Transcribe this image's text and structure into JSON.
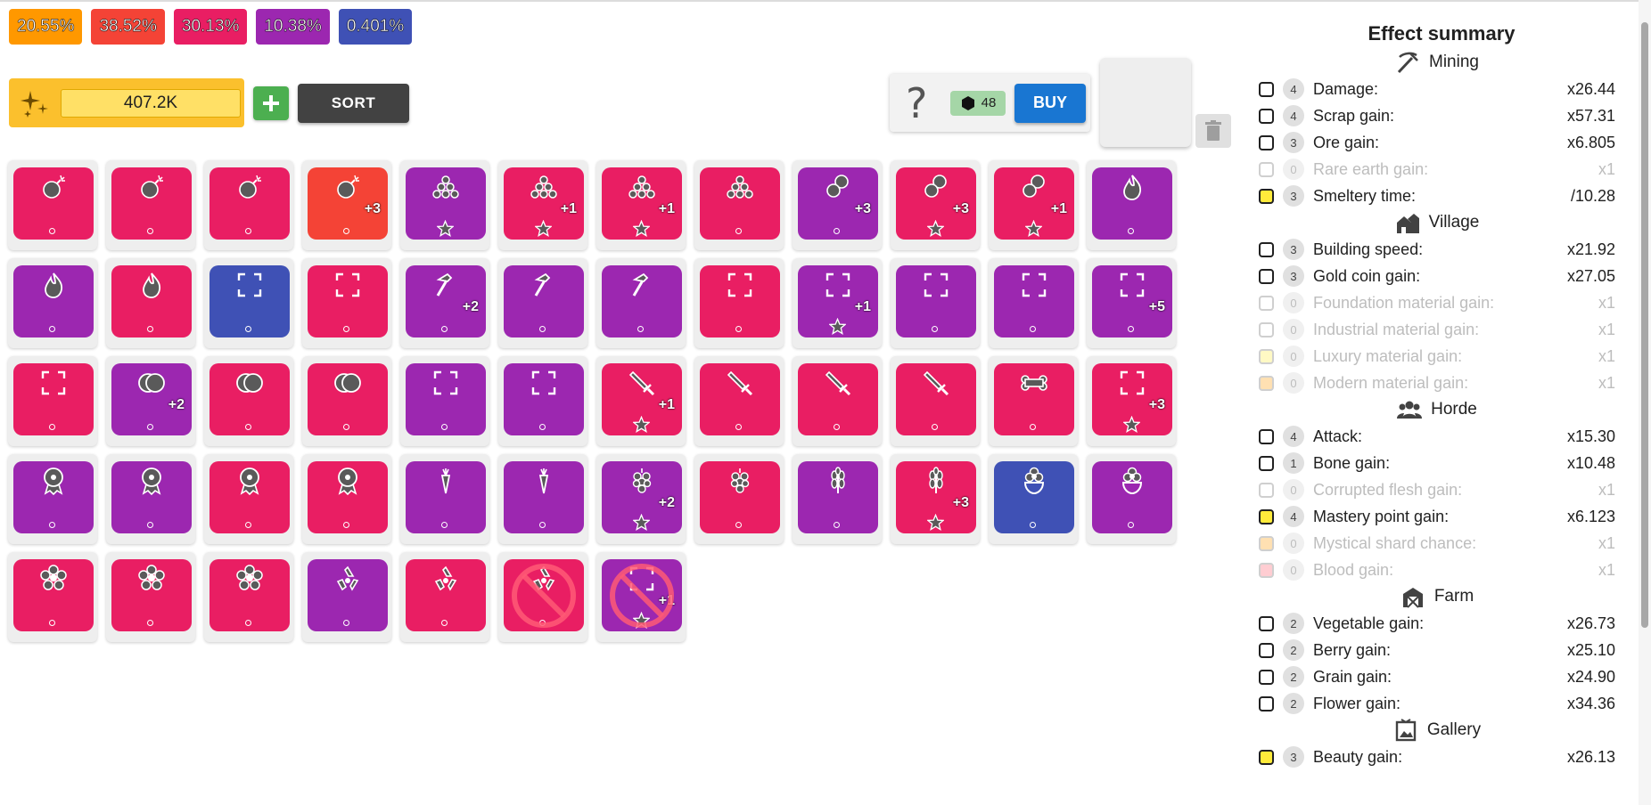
{
  "rarity_chips": [
    {
      "label": "20.55%",
      "color": "#ff9800"
    },
    {
      "label": "38.52%",
      "color": "#f44336"
    },
    {
      "label": "30.13%",
      "color": "#e91e63"
    },
    {
      "label": "10.38%",
      "color": "#9c27b0"
    },
    {
      "label": "0.401%",
      "color": "#3f51b5"
    }
  ],
  "currency": {
    "amount": "407.2K",
    "icon": "sparkle-icon"
  },
  "toolbar": {
    "sort_label": "SORT",
    "add_icon": "plus-icon"
  },
  "buy_panel": {
    "help": "?",
    "cost": "48",
    "cost_icon": "hexagon-icon",
    "buy_label": "BUY"
  },
  "colors": {
    "red": "#f44336",
    "pink": "#e91e63",
    "purple": "#9c27b0",
    "indigo": "#3f51b5"
  },
  "cards": [
    {
      "color": "pink",
      "icon": "bomb",
      "bonus": "",
      "star": false,
      "banned": false
    },
    {
      "color": "pink",
      "icon": "bomb",
      "bonus": "",
      "star": false,
      "banned": false
    },
    {
      "color": "pink",
      "icon": "bomb",
      "bonus": "",
      "star": false,
      "banned": false
    },
    {
      "color": "red",
      "icon": "bomb",
      "bonus": "+3",
      "star": false,
      "banned": false
    },
    {
      "color": "purple",
      "icon": "ore-pile",
      "bonus": "",
      "star": true,
      "banned": false
    },
    {
      "color": "pink",
      "icon": "ore-pile",
      "bonus": "+1",
      "star": true,
      "banned": false
    },
    {
      "color": "pink",
      "icon": "ore-pile",
      "bonus": "+1",
      "star": true,
      "banned": false
    },
    {
      "color": "pink",
      "icon": "ore-pile",
      "bonus": "",
      "star": false,
      "banned": false
    },
    {
      "color": "purple",
      "icon": "scrap",
      "bonus": "+3",
      "star": false,
      "banned": false
    },
    {
      "color": "pink",
      "icon": "scrap",
      "bonus": "+3",
      "star": true,
      "banned": false
    },
    {
      "color": "pink",
      "icon": "scrap",
      "bonus": "+1",
      "star": true,
      "banned": false
    },
    {
      "color": "purple",
      "icon": "fire",
      "bonus": "",
      "star": false,
      "banned": false
    },
    {
      "color": "purple",
      "icon": "fire",
      "bonus": "",
      "star": false,
      "banned": false
    },
    {
      "color": "pink",
      "icon": "fire",
      "bonus": "",
      "star": false,
      "banned": false
    },
    {
      "color": "indigo",
      "icon": "expand",
      "bonus": "",
      "star": false,
      "banned": false
    },
    {
      "color": "pink",
      "icon": "expand",
      "bonus": "",
      "star": false,
      "banned": false
    },
    {
      "color": "purple",
      "icon": "hammer",
      "bonus": "+2",
      "star": false,
      "banned": false
    },
    {
      "color": "purple",
      "icon": "hammer",
      "bonus": "",
      "star": false,
      "banned": false
    },
    {
      "color": "purple",
      "icon": "hammer",
      "bonus": "",
      "star": false,
      "banned": false
    },
    {
      "color": "pink",
      "icon": "expand",
      "bonus": "",
      "star": false,
      "banned": false
    },
    {
      "color": "purple",
      "icon": "expand",
      "bonus": "+1",
      "star": true,
      "banned": false
    },
    {
      "color": "purple",
      "icon": "expand",
      "bonus": "",
      "star": false,
      "banned": false
    },
    {
      "color": "purple",
      "icon": "expand",
      "bonus": "",
      "star": false,
      "banned": false
    },
    {
      "color": "purple",
      "icon": "expand",
      "bonus": "+5",
      "star": false,
      "banned": false
    },
    {
      "color": "pink",
      "icon": "expand",
      "bonus": "",
      "star": false,
      "banned": false
    },
    {
      "color": "purple",
      "icon": "coins",
      "bonus": "+2",
      "star": false,
      "banned": false
    },
    {
      "color": "pink",
      "icon": "coins",
      "bonus": "",
      "star": false,
      "banned": false
    },
    {
      "color": "pink",
      "icon": "coins",
      "bonus": "",
      "star": false,
      "banned": false
    },
    {
      "color": "purple",
      "icon": "expand",
      "bonus": "",
      "star": false,
      "banned": false
    },
    {
      "color": "purple",
      "icon": "expand",
      "bonus": "",
      "star": false,
      "banned": false
    },
    {
      "color": "pink",
      "icon": "sword",
      "bonus": "+1",
      "star": true,
      "banned": false
    },
    {
      "color": "pink",
      "icon": "sword",
      "bonus": "",
      "star": false,
      "banned": false
    },
    {
      "color": "pink",
      "icon": "sword",
      "bonus": "",
      "star": false,
      "banned": false
    },
    {
      "color": "pink",
      "icon": "sword",
      "bonus": "",
      "star": false,
      "banned": false
    },
    {
      "color": "pink",
      "icon": "bone",
      "bonus": "",
      "star": false,
      "banned": false
    },
    {
      "color": "pink",
      "icon": "expand",
      "bonus": "+3",
      "star": true,
      "banned": false
    },
    {
      "color": "purple",
      "icon": "medal",
      "bonus": "",
      "star": false,
      "banned": false
    },
    {
      "color": "purple",
      "icon": "medal",
      "bonus": "",
      "star": false,
      "banned": false
    },
    {
      "color": "pink",
      "icon": "medal",
      "bonus": "",
      "star": false,
      "banned": false
    },
    {
      "color": "pink",
      "icon": "medal",
      "bonus": "",
      "star": false,
      "banned": false
    },
    {
      "color": "purple",
      "icon": "carrot",
      "bonus": "",
      "star": false,
      "banned": false
    },
    {
      "color": "purple",
      "icon": "carrot",
      "bonus": "",
      "star": false,
      "banned": false
    },
    {
      "color": "purple",
      "icon": "grapes",
      "bonus": "+2",
      "star": true,
      "banned": false
    },
    {
      "color": "pink",
      "icon": "grapes",
      "bonus": "",
      "star": false,
      "banned": false
    },
    {
      "color": "purple",
      "icon": "grain",
      "bonus": "",
      "star": false,
      "banned": false
    },
    {
      "color": "pink",
      "icon": "grain",
      "bonus": "+3",
      "star": true,
      "banned": false
    },
    {
      "color": "indigo",
      "icon": "flower",
      "bonus": "",
      "star": false,
      "banned": false
    },
    {
      "color": "purple",
      "icon": "flower",
      "bonus": "",
      "star": false,
      "banned": false
    },
    {
      "color": "pink",
      "icon": "blossom",
      "bonus": "",
      "star": false,
      "banned": false
    },
    {
      "color": "pink",
      "icon": "blossom",
      "bonus": "",
      "star": false,
      "banned": false
    },
    {
      "color": "pink",
      "icon": "blossom",
      "bonus": "",
      "star": false,
      "banned": false
    },
    {
      "color": "purple",
      "icon": "recycle",
      "bonus": "",
      "star": false,
      "banned": false
    },
    {
      "color": "pink",
      "icon": "recycle",
      "bonus": "",
      "star": false,
      "banned": false
    },
    {
      "color": "pink",
      "icon": "recycle",
      "bonus": "",
      "star": false,
      "banned": true
    },
    {
      "color": "purple",
      "icon": "expand",
      "bonus": "+1",
      "star": true,
      "banned": true
    }
  ],
  "summary": {
    "title": "Effect summary",
    "sections": [
      {
        "name": "Mining",
        "icon": "pickaxe-icon",
        "rows": [
          {
            "count": "4",
            "label": "Damage:",
            "value": "x26.44",
            "dim": false,
            "cb": "#ffffff"
          },
          {
            "count": "4",
            "label": "Scrap gain:",
            "value": "x57.31",
            "dim": false,
            "cb": "#ffffff"
          },
          {
            "count": "3",
            "label": "Ore gain:",
            "value": "x6.805",
            "dim": false,
            "cb": "#ffffff"
          },
          {
            "count": "0",
            "label": "Rare earth gain:",
            "value": "x1",
            "dim": true,
            "cb": "#ffffff"
          },
          {
            "count": "3",
            "label": "Smeltery time:",
            "value": "/10.28",
            "dim": false,
            "cb": "#ffeb3b"
          }
        ]
      },
      {
        "name": "Village",
        "icon": "village-icon",
        "rows": [
          {
            "count": "3",
            "label": "Building speed:",
            "value": "x21.92",
            "dim": false,
            "cb": "#ffffff"
          },
          {
            "count": "3",
            "label": "Gold coin gain:",
            "value": "x27.05",
            "dim": false,
            "cb": "#ffffff"
          },
          {
            "count": "0",
            "label": "Foundation material gain:",
            "value": "x1",
            "dim": true,
            "cb": "#ffffff"
          },
          {
            "count": "0",
            "label": "Industrial material gain:",
            "value": "x1",
            "dim": true,
            "cb": "#ffffff"
          },
          {
            "count": "0",
            "label": "Luxury material gain:",
            "value": "x1",
            "dim": true,
            "cb": "#fff9c4"
          },
          {
            "count": "0",
            "label": "Modern material gain:",
            "value": "x1",
            "dim": true,
            "cb": "#ffe0b2"
          }
        ]
      },
      {
        "name": "Horde",
        "icon": "group-icon",
        "rows": [
          {
            "count": "4",
            "label": "Attack:",
            "value": "x15.30",
            "dim": false,
            "cb": "#ffffff"
          },
          {
            "count": "1",
            "label": "Bone gain:",
            "value": "x10.48",
            "dim": false,
            "cb": "#ffffff"
          },
          {
            "count": "0",
            "label": "Corrupted flesh gain:",
            "value": "x1",
            "dim": true,
            "cb": "#ffffff"
          },
          {
            "count": "4",
            "label": "Mastery point gain:",
            "value": "x6.123",
            "dim": false,
            "cb": "#ffeb3b"
          },
          {
            "count": "0",
            "label": "Mystical shard chance:",
            "value": "x1",
            "dim": true,
            "cb": "#ffe0b2"
          },
          {
            "count": "0",
            "label": "Blood gain:",
            "value": "x1",
            "dim": true,
            "cb": "#ffcdd2"
          }
        ]
      },
      {
        "name": "Farm",
        "icon": "barn-icon",
        "rows": [
          {
            "count": "2",
            "label": "Vegetable gain:",
            "value": "x26.73",
            "dim": false,
            "cb": "#ffffff"
          },
          {
            "count": "2",
            "label": "Berry gain:",
            "value": "x25.10",
            "dim": false,
            "cb": "#ffffff"
          },
          {
            "count": "2",
            "label": "Grain gain:",
            "value": "x24.90",
            "dim": false,
            "cb": "#ffffff"
          },
          {
            "count": "2",
            "label": "Flower gain:",
            "value": "x34.36",
            "dim": false,
            "cb": "#ffffff"
          }
        ]
      },
      {
        "name": "Gallery",
        "icon": "picture-icon",
        "rows": [
          {
            "count": "3",
            "label": "Beauty gain:",
            "value": "x26.13",
            "dim": false,
            "cb": "#ffeb3b"
          }
        ]
      }
    ]
  }
}
